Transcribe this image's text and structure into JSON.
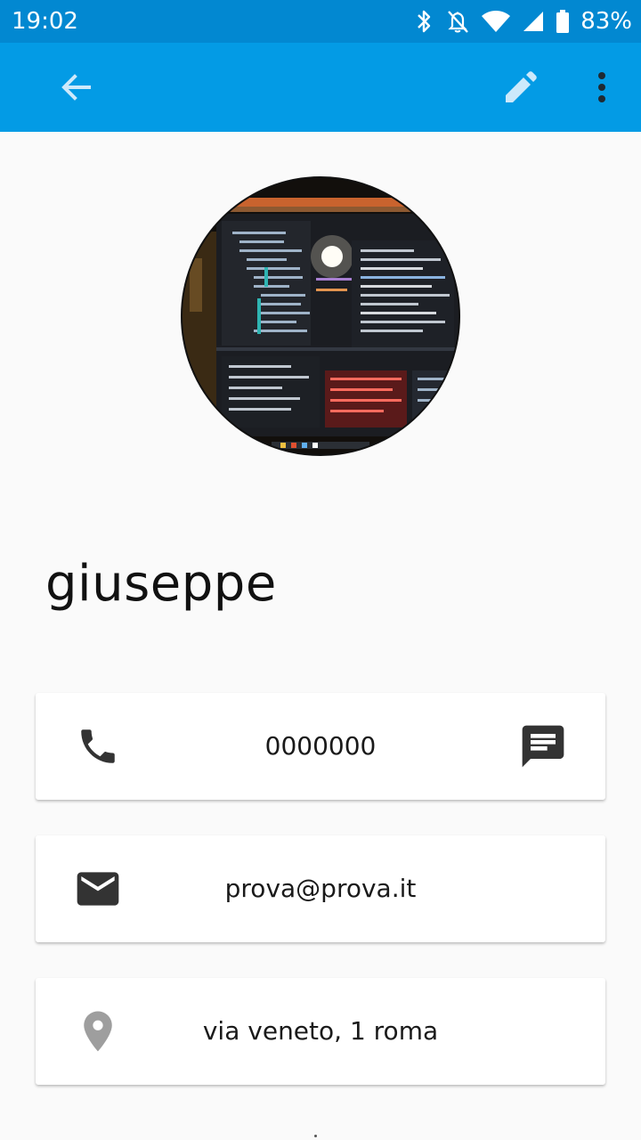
{
  "status_bar": {
    "time": "19:02",
    "battery_percent": "83%",
    "icons": [
      "bluetooth-icon",
      "notifications-off-icon",
      "wifi-icon",
      "cellular-signal-icon",
      "battery-icon"
    ]
  },
  "app_bar": {
    "back_icon": "arrow-back-icon",
    "edit_icon": "pencil-icon",
    "more_icon": "more-vert-icon"
  },
  "contact": {
    "name": "giuseppe",
    "avatar_icon": "contact-photo",
    "phone": "0000000",
    "email": "prova@prova.it",
    "address": "via veneto, 1 roma"
  },
  "colors": {
    "status_bar": "#0288d1",
    "app_bar": "#039be5",
    "background": "#fafafa",
    "icon_dark": "#333333",
    "icon_grey": "#9e9e9e"
  }
}
